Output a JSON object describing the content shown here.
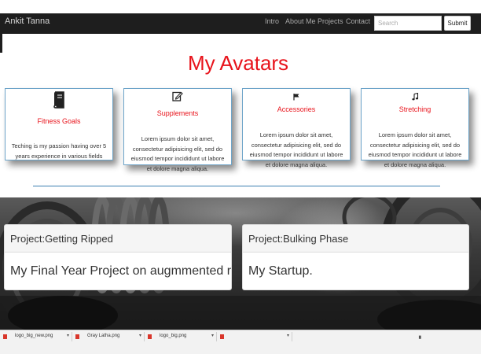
{
  "navbar": {
    "brand": "Ankit Tanna",
    "links": [
      "Intro",
      "About Me",
      "Projects",
      "Contact"
    ],
    "search_placeholder": "Search",
    "submit_label": "Submit"
  },
  "heading": "My Avatars",
  "cards": [
    {
      "icon": "book-icon",
      "title": "Fitness Goals",
      "text": "Teching is my passion having over 5 years experience in various fields"
    },
    {
      "icon": "edit-icon",
      "title": "Supplements",
      "text": "Lorem ipsum dolor sit amet, consectetur adipisicing elit, sed do eiusmod tempor incididunt ut labore et dolore magna aliqua."
    },
    {
      "icon": "flag-icon",
      "title": "Accessories",
      "text": "Lorem ipsum dolor sit amet, consectetur adipisicing elit, sed do eiusmod tempor incididunt ut labore et dolore magna aliqua."
    },
    {
      "icon": "music-icon",
      "title": "Stretching",
      "text": "Lorem ipsum dolor sit amet, consectetur adipisicing elit, sed do eiusmod tempor incididunt ut labore et dolore magna aliqua."
    }
  ],
  "projects": [
    {
      "heading": "Project:Getting Ripped",
      "body": "My Final Year Project on augmmented reality."
    },
    {
      "heading": "Project:Bulking Phase",
      "body": "My Startup."
    }
  ],
  "downloads": [
    "logo_big_new.png",
    "Gray Latha.png",
    "logo_big.png",
    ""
  ],
  "colors": {
    "accent": "#e8131b",
    "navbar": "#1e1e1e",
    "card_border": "#6da4c9",
    "divider": "#3c7fb0"
  }
}
